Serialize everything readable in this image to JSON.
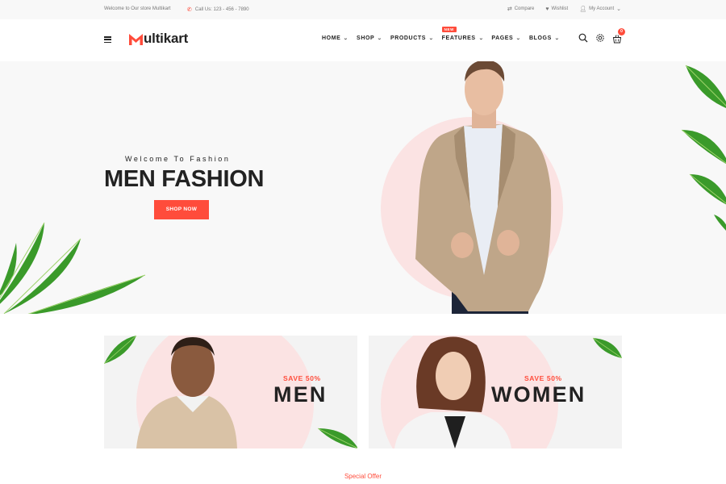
{
  "topbar": {
    "welcome": "Welcome to Our store Multikart",
    "phone": "Call Us: 123 - 456 - 7890",
    "compare": "Compare",
    "wishlist": "Wishlist",
    "account": "My Account"
  },
  "logo": {
    "text": "ultikart"
  },
  "nav": {
    "home": "HOME",
    "shop": "SHOP",
    "products": "PRODUCTS",
    "features": "FEATURES",
    "features_badge": "NEW",
    "pages": "PAGES",
    "blogs": "BLOGS"
  },
  "cart": {
    "count": "0"
  },
  "hero": {
    "subtitle": "Welcome To Fashion",
    "title": "MEN FASHION",
    "button": "SHOP NOW"
  },
  "banners": [
    {
      "save": "SAVE 50%",
      "label": "MEN"
    },
    {
      "save": "SAVE 50%",
      "label": "WOMEN"
    }
  ],
  "section": {
    "title": "Special Offer"
  },
  "colors": {
    "accent": "#ff4c3b",
    "pink": "#fbe3e3",
    "dark": "#222222"
  },
  "icons": [
    "phone-icon",
    "compare-icon",
    "heart-icon",
    "user-icon",
    "menu-icon",
    "search-icon",
    "settings-icon",
    "cart-icon"
  ]
}
